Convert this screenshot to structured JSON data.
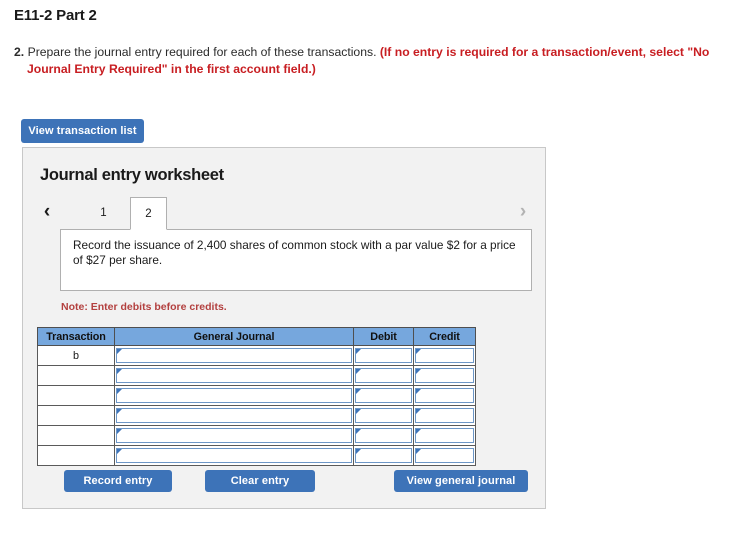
{
  "page": {
    "title": "E11-2 Part 2"
  },
  "instruction": {
    "number": "2.",
    "black_text": "Prepare the journal entry required for each of these transactions.",
    "red_text_line1": "(If no entry is required for a transaction/event, select \"No",
    "red_text_line2": "Journal Entry Required\" in the first account field.)"
  },
  "toolbar": {
    "view_transaction_list_label": "View transaction list"
  },
  "worksheet": {
    "title": "Journal entry worksheet",
    "nav": {
      "prev_icon": "chevron-left-icon",
      "next_icon": "chevron-right-icon",
      "prev_glyph": "‹",
      "next_glyph": "›"
    },
    "tabs": [
      {
        "label": "1",
        "active": false
      },
      {
        "label": "2",
        "active": true
      }
    ],
    "description": "Record the issuance of 2,400 shares of common stock with a par value $2 for a price of $27 per share.",
    "note": "Note: Enter debits before credits.",
    "table": {
      "headers": [
        "Transaction",
        "General Journal",
        "Debit",
        "Credit"
      ],
      "rows": [
        {
          "transaction": "b",
          "general_journal": "",
          "debit": "",
          "credit": ""
        },
        {
          "transaction": "",
          "general_journal": "",
          "debit": "",
          "credit": ""
        },
        {
          "transaction": "",
          "general_journal": "",
          "debit": "",
          "credit": ""
        },
        {
          "transaction": "",
          "general_journal": "",
          "debit": "",
          "credit": ""
        },
        {
          "transaction": "",
          "general_journal": "",
          "debit": "",
          "credit": ""
        },
        {
          "transaction": "",
          "general_journal": "",
          "debit": "",
          "credit": ""
        }
      ]
    },
    "buttons": {
      "record_entry": "Record entry",
      "clear_entry": "Clear entry",
      "view_general_journal": "View general journal"
    }
  },
  "colors": {
    "primary_blue": "#3d73b8",
    "table_header_blue": "#76a7dd",
    "red_text": "#c81e22",
    "note_red": "#b3403f",
    "panel_bg": "#f2f2f2"
  }
}
